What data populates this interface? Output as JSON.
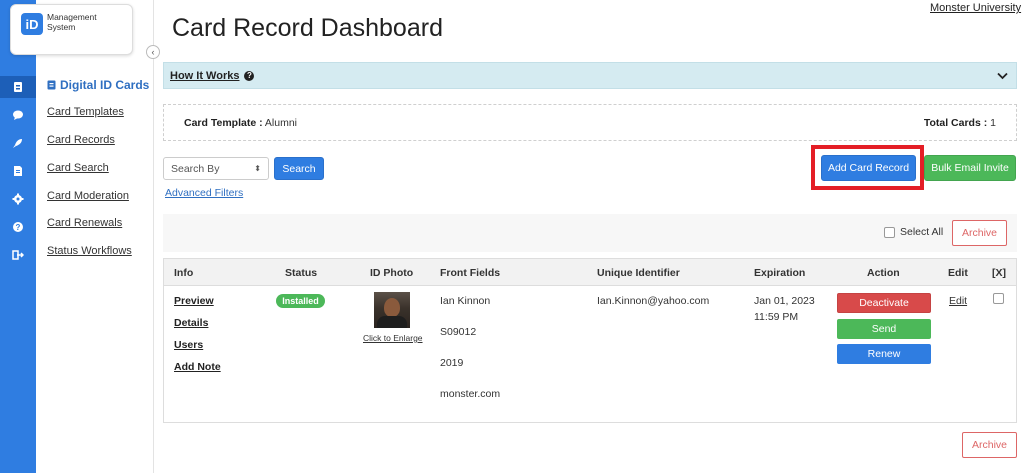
{
  "app": {
    "logo_badge": "iD",
    "logo_text": "Management System",
    "org_link": "Monster University"
  },
  "rail": {
    "icons": [
      "id-card-icon",
      "chat-icon",
      "rocket-icon",
      "document-icon",
      "gear-icon",
      "help-icon",
      "logout-icon"
    ]
  },
  "sidebar": {
    "section_title": "Digital ID Cards",
    "items": [
      {
        "label": "Card Templates"
      },
      {
        "label": "Card Records"
      },
      {
        "label": "Card Search"
      },
      {
        "label": "Card Moderation"
      },
      {
        "label": "Card Renewals"
      },
      {
        "label": "Status Workflows"
      }
    ]
  },
  "page": {
    "title": "Card Record Dashboard",
    "how_it_works": "How It Works",
    "template_label": "Card Template :",
    "template_value": "Alumni",
    "total_label": "Total Cards :",
    "total_value": "1"
  },
  "search": {
    "select_value": "Search By",
    "button": "Search",
    "advanced_filters": "Advanced Filters"
  },
  "toolbar": {
    "add_card_record": "Add Card Record",
    "bulk_email_invite": "Bulk Email Invite",
    "select_all": "Select All",
    "archive": "Archive"
  },
  "table": {
    "headers": [
      "Info",
      "Status",
      "ID Photo",
      "Front Fields",
      "Unique Identifier",
      "Expiration",
      "Action",
      "Edit",
      "[X]"
    ],
    "row": {
      "info_links": [
        "Preview",
        "Details",
        "Users",
        "Add Note"
      ],
      "status": "Installed",
      "photo_caption": "Click to Enlarge",
      "front_fields": [
        "Ian Kinnon",
        "S09012",
        "2019",
        "monster.com"
      ],
      "unique_identifier": "Ian.Kinnon@yahoo.com",
      "expiration_date": "Jan 01, 2023",
      "expiration_time": "11:59 PM",
      "actions": [
        "Deactivate",
        "Send",
        "Renew"
      ],
      "edit": "Edit"
    }
  },
  "colors": {
    "primary": "#2f7de1",
    "success": "#4cb859",
    "danger": "#d84a4a",
    "highlight": "#e41e26",
    "info_bar": "#d5ebf1"
  }
}
